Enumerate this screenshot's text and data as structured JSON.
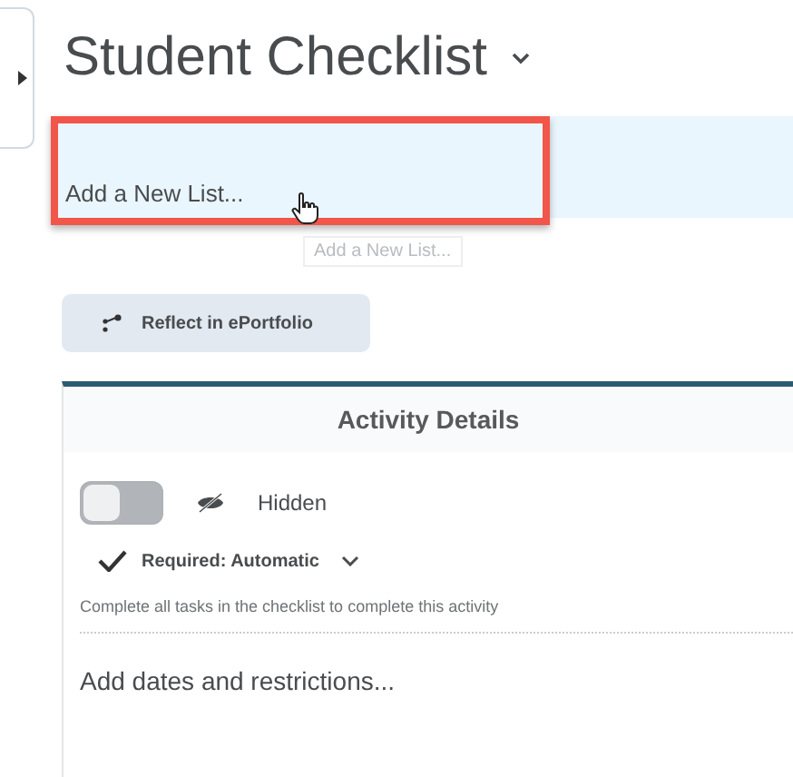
{
  "title": "Student Checklist",
  "add_list": {
    "label": "Add a New List...",
    "highlighted": true
  },
  "tooltip": "Add a New List...",
  "reflect_button": "Reflect in ePortfolio",
  "panel": {
    "header": "Activity Details",
    "visibility": {
      "on": false,
      "label": "Hidden"
    },
    "completion": {
      "label": "Required: Automatic"
    },
    "description": "Complete all tasks in the checklist to complete this activity",
    "dates_link": "Add dates and restrictions..."
  }
}
